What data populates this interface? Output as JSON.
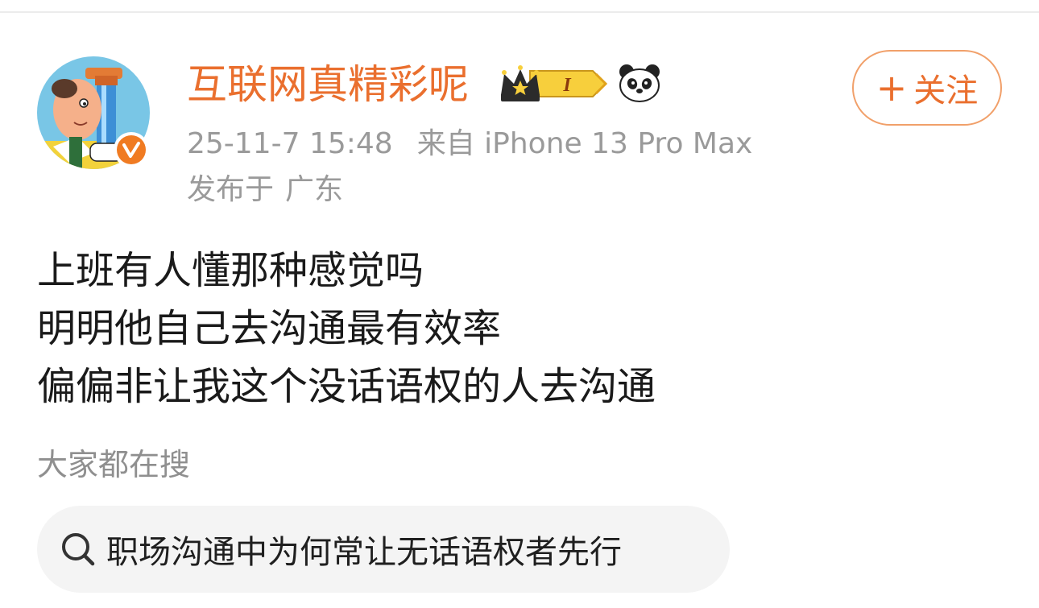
{
  "post": {
    "author": {
      "name": "互联网真精彩呢",
      "vip_level": "I",
      "verified": true
    },
    "timestamp": "25-11-7 15:48",
    "source": "来自 iPhone 13 Pro Max",
    "location_prefix": "发布于",
    "location": "广东",
    "follow_label": "关注",
    "follow_plus": "+",
    "content_lines": [
      "上班有人懂那种感觉吗",
      "明明他自己去沟通最有效率",
      "偏偏非让我这个没话语权的人去沟通"
    ]
  },
  "trending": {
    "heading": "大家都在搜",
    "query": "职场沟通中为何常让无话语权者先行"
  },
  "colors": {
    "accent": "#ea6f2e",
    "meta_text": "#9a9a9a",
    "body_text": "#1a1a1a",
    "pill_bg": "#f4f4f4"
  },
  "icons": {
    "avatar": "cartoon-avatar",
    "verified": "verified-badge-icon",
    "vip": "crown-vip-badge-icon",
    "panda": "panda-icon",
    "search": "search-icon"
  }
}
